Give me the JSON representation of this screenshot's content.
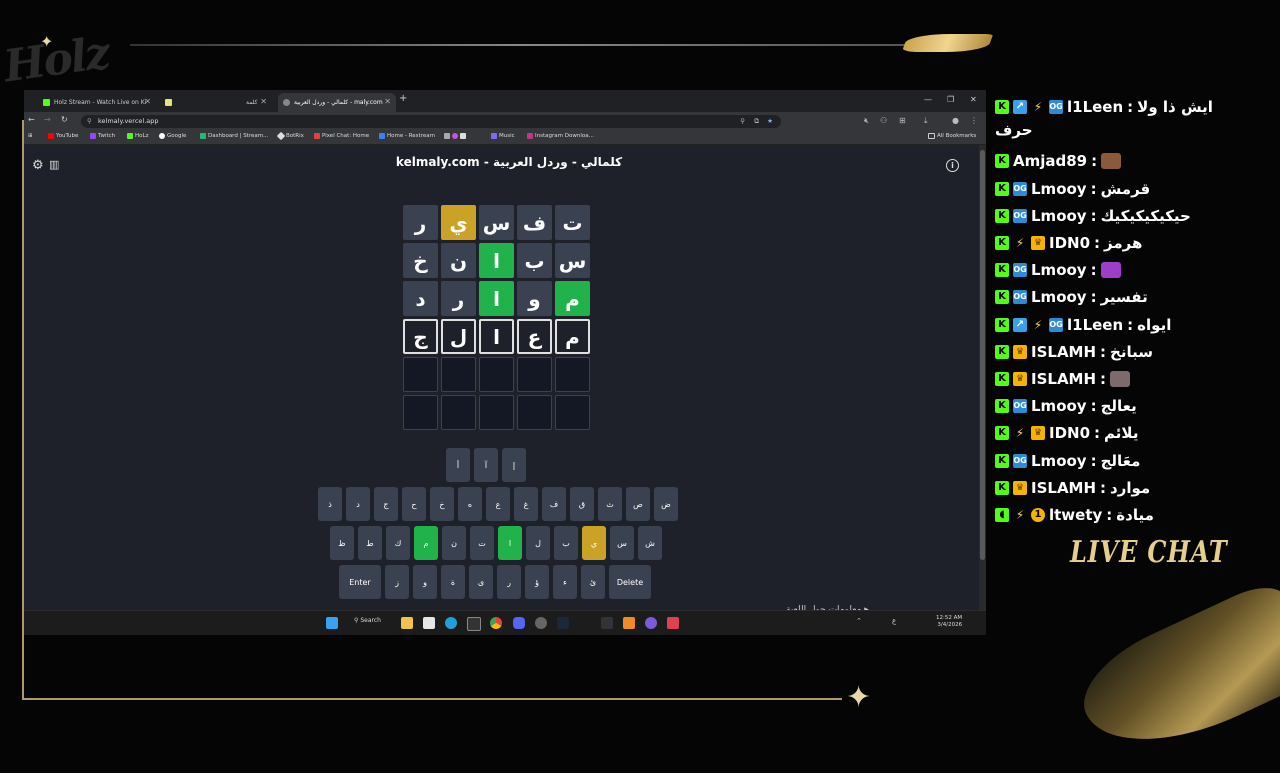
{
  "overlay": {
    "logo_text": "Holz",
    "live_chat_label": "LIVE CHAT",
    "accent_gold": "#e4cf8c"
  },
  "browser": {
    "tabs": [
      {
        "label": "Holz Stream - Watch Live on Ki",
        "favicon_color": "#53fc18",
        "active": false
      },
      {
        "label": "كلمة",
        "favicon_color": "#e8e27a",
        "active": false
      },
      {
        "label": "كلمالي - وردل العربية - maly.com",
        "favicon_color": "#888888",
        "active": true
      }
    ],
    "url": "kelmaly.vercel.app",
    "bookmarks": [
      {
        "label": "YouTube",
        "color": "#ff0000"
      },
      {
        "label": "Twitch",
        "color": "#9146ff"
      },
      {
        "label": "HoLz",
        "color": "#53fc18"
      },
      {
        "label": "Google",
        "color": "#ffffff"
      },
      {
        "label": "Dashboard | Stream...",
        "color": "#2bb673"
      },
      {
        "label": "BotRix",
        "color": "#dddddd"
      },
      {
        "label": "Pixel Chat: Home",
        "color": "#e04040"
      },
      {
        "label": "Home - Restream",
        "color": "#3b82f6"
      },
      {
        "label": "Music",
        "color": "#7c6cf0"
      },
      {
        "label": "Instagram Downloa...",
        "color": "#c13584"
      }
    ],
    "all_bookmarks_label": "All Bookmarks"
  },
  "page": {
    "title": "kelmaly.com - كلمالي - وردل العربية",
    "board": [
      [
        {
          "l": "ت",
          "s": "absent"
        },
        {
          "l": "ف",
          "s": "absent"
        },
        {
          "l": "س",
          "s": "absent"
        },
        {
          "l": "ي",
          "s": "present"
        },
        {
          "l": "ر",
          "s": "absent"
        }
      ],
      [
        {
          "l": "س",
          "s": "absent"
        },
        {
          "l": "ب",
          "s": "absent"
        },
        {
          "l": "ا",
          "s": "correct"
        },
        {
          "l": "ن",
          "s": "absent"
        },
        {
          "l": "خ",
          "s": "absent"
        }
      ],
      [
        {
          "l": "م",
          "s": "correct"
        },
        {
          "l": "و",
          "s": "absent"
        },
        {
          "l": "ا",
          "s": "correct"
        },
        {
          "l": "ر",
          "s": "absent"
        },
        {
          "l": "د",
          "s": "absent"
        }
      ],
      [
        {
          "l": "م",
          "s": "typed"
        },
        {
          "l": "ع",
          "s": "typed"
        },
        {
          "l": "ا",
          "s": "typed"
        },
        {
          "l": "ل",
          "s": "typed"
        },
        {
          "l": "ج",
          "s": "typed"
        }
      ],
      [
        {
          "l": "",
          "s": "empty"
        },
        {
          "l": "",
          "s": "empty"
        },
        {
          "l": "",
          "s": "empty"
        },
        {
          "l": "",
          "s": "empty"
        },
        {
          "l": "",
          "s": "empty"
        }
      ],
      [
        {
          "l": "",
          "s": "empty"
        },
        {
          "l": "",
          "s": "empty"
        },
        {
          "l": "",
          "s": "empty"
        },
        {
          "l": "",
          "s": "empty"
        },
        {
          "l": "",
          "s": "empty"
        }
      ]
    ],
    "keyboard": [
      [
        {
          "k": "إ"
        },
        {
          "k": "آ"
        },
        {
          "k": "أ"
        }
      ],
      [
        {
          "k": "ض"
        },
        {
          "k": "ص"
        },
        {
          "k": "ث"
        },
        {
          "k": "ق"
        },
        {
          "k": "ف"
        },
        {
          "k": "غ"
        },
        {
          "k": "ع"
        },
        {
          "k": "ه"
        },
        {
          "k": "خ"
        },
        {
          "k": "ح"
        },
        {
          "k": "ج"
        },
        {
          "k": "د"
        },
        {
          "k": "ذ"
        }
      ],
      [
        {
          "k": "ش"
        },
        {
          "k": "س"
        },
        {
          "k": "ي",
          "s": "present"
        },
        {
          "k": "ب"
        },
        {
          "k": "ل"
        },
        {
          "k": "ا",
          "s": "correct"
        },
        {
          "k": "ت"
        },
        {
          "k": "ن"
        },
        {
          "k": "م",
          "s": "correct"
        },
        {
          "k": "ك"
        },
        {
          "k": "ط"
        },
        {
          "k": "ظ"
        }
      ],
      [
        {
          "k": "Delete",
          "wide": true
        },
        {
          "k": "ئ"
        },
        {
          "k": "ء"
        },
        {
          "k": "ؤ"
        },
        {
          "k": "ر"
        },
        {
          "k": "ى"
        },
        {
          "k": "ة"
        },
        {
          "k": "و"
        },
        {
          "k": "ز"
        },
        {
          "k": "Enter",
          "wide": true
        }
      ]
    ],
    "footer_link": "معلومات حول اللعبة ▸"
  },
  "taskbar": {
    "search_label": "Search",
    "time": "12:52 AM",
    "date": "3/4/2026",
    "lang": "ع"
  },
  "chat": [
    {
      "badges": [
        "k",
        "arrow",
        "star",
        "og"
      ],
      "user": "l1Leen",
      "text": "ايش ذا ولا",
      "cont": "حرف"
    },
    {
      "badges": [
        "k"
      ],
      "user": "Amjad89",
      "text": "",
      "emote": "#8a5a3c"
    },
    {
      "badges": [
        "k",
        "og"
      ],
      "user": "Lmooy",
      "text": "قرمش"
    },
    {
      "badges": [
        "k",
        "og"
      ],
      "user": "Lmooy",
      "text": "حيكيكيكيكيك"
    },
    {
      "badges": [
        "k",
        "star",
        "crown"
      ],
      "user": "IDN0",
      "text": "هرمز"
    },
    {
      "badges": [
        "k",
        "og"
      ],
      "user": "Lmooy",
      "text": "",
      "emote": "#9b3fc9"
    },
    {
      "badges": [
        "k",
        "og"
      ],
      "user": "Lmooy",
      "text": "تفسير"
    },
    {
      "badges": [
        "k",
        "arrow",
        "star",
        "og"
      ],
      "user": "l1Leen",
      "text": "ايواه"
    },
    {
      "badges": [
        "k",
        "crown"
      ],
      "user": "ISLAMH",
      "text": "سبانخ"
    },
    {
      "badges": [
        "k",
        "crown"
      ],
      "user": "ISLAMH",
      "text": "",
      "emote": "#7d6a6a"
    },
    {
      "badges": [
        "k",
        "og"
      ],
      "user": "Lmooy",
      "text": "يعالج"
    },
    {
      "badges": [
        "k",
        "star",
        "crown"
      ],
      "user": "IDN0",
      "text": "يلائم"
    },
    {
      "badges": [
        "k",
        "og"
      ],
      "user": "Lmooy",
      "text": "معَالج"
    },
    {
      "badges": [
        "k",
        "crown"
      ],
      "user": "ISLAMH",
      "text": "موارد"
    },
    {
      "badges": [
        "k2",
        "star",
        "one"
      ],
      "user": "ltwety",
      "text": "ميادة"
    }
  ]
}
